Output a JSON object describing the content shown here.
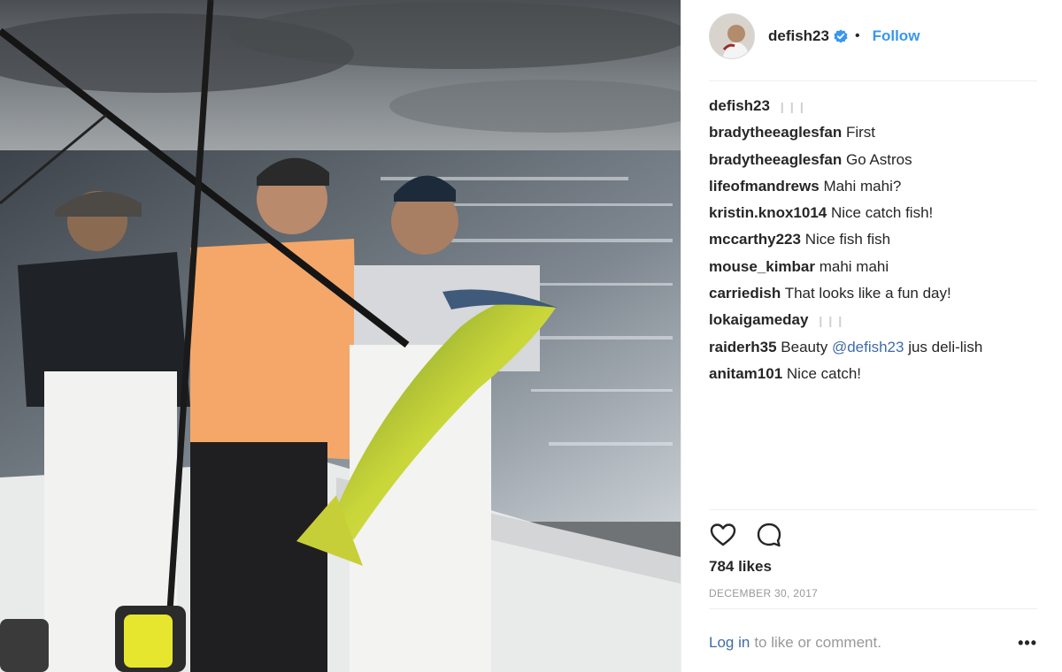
{
  "post": {
    "author": "defish23",
    "follow_label": "Follow",
    "separator": "•",
    "verified_icon": "verified-badge-icon",
    "accent_color": "#3897f0",
    "link_color": "#3f6ba8"
  },
  "comments": [
    {
      "user": "defish23",
      "pre": "",
      "mention": "",
      "post": "",
      "emoji": "❙❙❙"
    },
    {
      "user": "bradytheeaglesfan",
      "pre": "First",
      "mention": "",
      "post": "",
      "emoji": ""
    },
    {
      "user": "bradytheeaglesfan",
      "pre": "Go Astros",
      "mention": "",
      "post": "",
      "emoji": ""
    },
    {
      "user": "lifeofmandrews",
      "pre": "Mahi mahi?",
      "mention": "",
      "post": "",
      "emoji": ""
    },
    {
      "user": "kristin.knox1014",
      "pre": "Nice catch fish!",
      "mention": "",
      "post": "",
      "emoji": ""
    },
    {
      "user": "mccarthy223",
      "pre": "Nice fish fish",
      "mention": "",
      "post": "",
      "emoji": ""
    },
    {
      "user": "mouse_kimbar",
      "pre": "mahi mahi",
      "mention": "",
      "post": "",
      "emoji": ""
    },
    {
      "user": "carriedish",
      "pre": "That looks like a fun day!",
      "mention": "",
      "post": "",
      "emoji": ""
    },
    {
      "user": "lokaigameday",
      "pre": "",
      "mention": "",
      "post": "",
      "emoji": "❙❙❙"
    },
    {
      "user": "raiderh35",
      "pre": "Beauty ",
      "mention": "@defish23",
      "post": " jus deli-lish",
      "emoji": ""
    },
    {
      "user": "anitam101",
      "pre": "Nice catch!",
      "mention": "",
      "post": "",
      "emoji": ""
    }
  ],
  "actions": {
    "like_icon": "heart-icon",
    "comment_icon": "comment-bubble-icon",
    "likes_text": "784 likes",
    "date_text": "DECEMBER 30, 2017"
  },
  "footer": {
    "login_label": "Log in",
    "login_suffix": "to like or comment.",
    "more_label": "•••",
    "more_icon": "more-options-icon"
  }
}
